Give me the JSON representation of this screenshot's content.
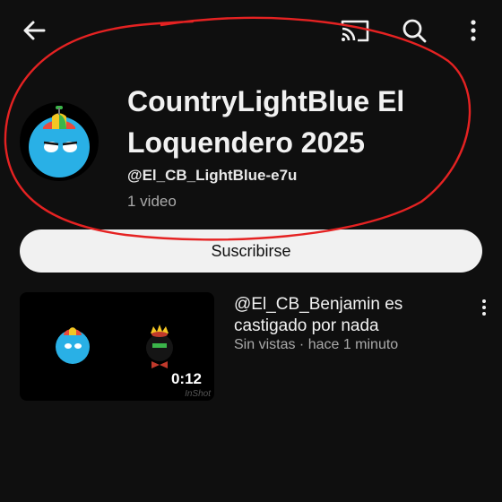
{
  "header": {
    "back_icon": "arrow-back-icon",
    "cast_icon": "cast-icon",
    "search_icon": "search-icon",
    "more_icon": "more-vertical-icon"
  },
  "channel": {
    "name": "CountryLightBlue El Loquendero 2025",
    "handle": "@El_CB_LightBlue-e7u",
    "video_count": "1 video"
  },
  "subscribe": {
    "label": "Suscribirse"
  },
  "videos": [
    {
      "title": "@El_CB_Benjamin es castigado por nada",
      "meta": "Sin vistas · hace 1 minuto",
      "duration": "0:12",
      "watermark": "InShot"
    }
  ],
  "colors": {
    "background": "#0f0f0f",
    "annotation": "#e52222",
    "avatar_ball": "#29b0e6",
    "button_bg": "#f1f1f1"
  }
}
